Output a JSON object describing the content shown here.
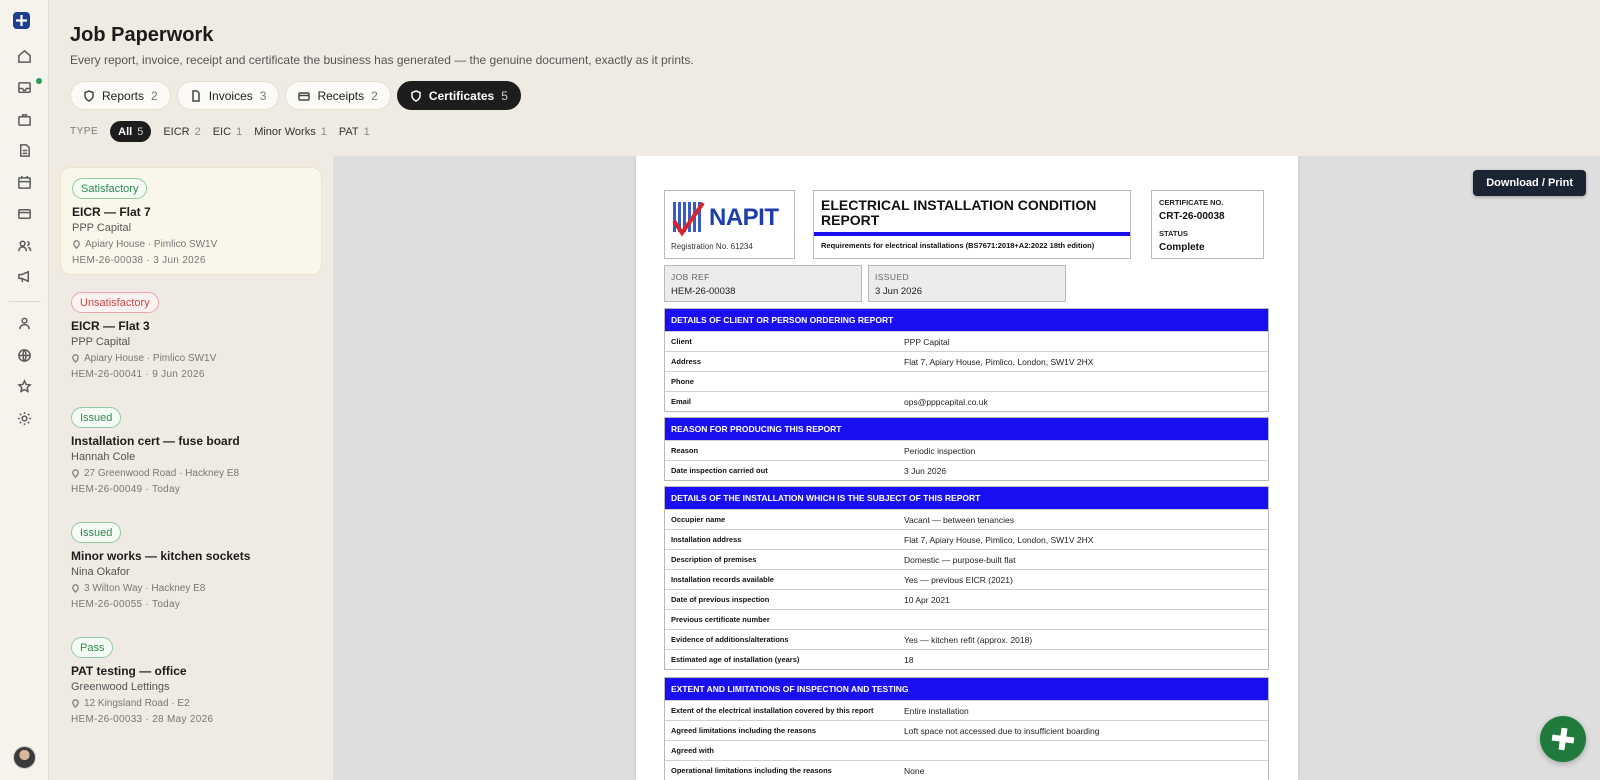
{
  "sidebar": {
    "icons": [
      "home-icon",
      "inbox-icon",
      "briefcase-icon",
      "document-icon",
      "calendar-icon",
      "card-icon",
      "people-icon",
      "megaphone-icon",
      "person-icon",
      "globe-icon",
      "star-icon",
      "settings-icon"
    ]
  },
  "header": {
    "title": "Job Paperwork",
    "subtitle": "Every report, invoice, receipt and certificate the business has generated — the genuine document, exactly as it prints.",
    "tabs": [
      {
        "label": "Reports",
        "count": "2"
      },
      {
        "label": "Invoices",
        "count": "3"
      },
      {
        "label": "Receipts",
        "count": "2"
      },
      {
        "label": "Certificates",
        "count": "5"
      }
    ],
    "type_label": "TYPE",
    "types": [
      {
        "label": "All",
        "count": "5"
      },
      {
        "label": "EICR",
        "count": "2"
      },
      {
        "label": "EIC",
        "count": "1"
      },
      {
        "label": "Minor Works",
        "count": "1"
      },
      {
        "label": "PAT",
        "count": "1"
      }
    ]
  },
  "list": [
    {
      "badge": "Satisfactory",
      "title": "EICR — Flat 7",
      "client": "PPP Capital",
      "address": "Apiary House · Pimlico SW1V",
      "meta": "HEM-26-00038 · 3 Jun 2026"
    },
    {
      "badge": "Unsatisfactory",
      "title": "EICR — Flat 3",
      "client": "PPP Capital",
      "address": "Apiary House · Pimlico SW1V",
      "meta": "HEM-26-00041 · 9 Jun 2026"
    },
    {
      "badge": "Issued",
      "title": "Installation cert — fuse board",
      "client": "Hannah Cole",
      "address": "27 Greenwood Road · Hackney E8",
      "meta": "HEM-26-00049 · Today"
    },
    {
      "badge": "Issued",
      "title": "Minor works — kitchen sockets",
      "client": "Nina Okafor",
      "address": "3 Wilton Way · Hackney E8",
      "meta": "HEM-26-00055 · Today"
    },
    {
      "badge": "Pass",
      "title": "PAT testing — office",
      "client": "Greenwood Lettings",
      "address": "12 Kingsland Road · E2",
      "meta": "HEM-26-00033 · 28 May 2026"
    }
  ],
  "viewer": {
    "download_label": "Download / Print"
  },
  "certificate": {
    "logo_text": "NAPIT",
    "registration": "Registration No. 61234",
    "title": "ELECTRICAL INSTALLATION CONDITION REPORT",
    "subtitle": "Requirements for electrical installations (BS7671:2018+A2:2022 18th edition)",
    "cert_no_label": "CERTIFICATE NO.",
    "cert_no": "CRT-26-00038",
    "status_label": "STATUS",
    "status": "Complete",
    "job_ref_label": "JOB REF",
    "job_ref": "HEM-26-00038",
    "issued_label": "ISSUED",
    "issued": "3 Jun 2026",
    "sections": [
      {
        "title": "DETAILS OF CLIENT OR PERSON ORDERING REPORT",
        "rows": [
          {
            "k": "Client",
            "v": "PPP Capital"
          },
          {
            "k": "Address",
            "v": "Flat 7, Apiary House, Pimlico, London, SW1V 2HX"
          },
          {
            "k": "Phone",
            "v": ""
          },
          {
            "k": "Email",
            "v": "ops@pppcapital.co.uk"
          }
        ]
      },
      {
        "title": "REASON FOR PRODUCING THIS REPORT",
        "rows": [
          {
            "k": "Reason",
            "v": "Periodic inspection"
          },
          {
            "k": "Date inspection carried out",
            "v": "3 Jun 2026"
          }
        ]
      },
      {
        "title": "DETAILS OF THE INSTALLATION WHICH IS THE SUBJECT OF THIS REPORT",
        "rows": [
          {
            "k": "Occupier name",
            "v": "Vacant — between tenancies"
          },
          {
            "k": "Installation address",
            "v": "Flat 7, Apiary House, Pimlico, London, SW1V 2HX"
          },
          {
            "k": "Description of premises",
            "v": "Domestic — purpose-built flat"
          },
          {
            "k": "Installation records available",
            "v": "Yes — previous EICR (2021)"
          },
          {
            "k": "Date of previous inspection",
            "v": "10 Apr 2021"
          },
          {
            "k": "Previous certificate number",
            "v": ""
          },
          {
            "k": "Evidence of additions/alterations",
            "v": "Yes — kitchen refit (approx. 2018)"
          },
          {
            "k": "Estimated age of installation (years)",
            "v": "18"
          }
        ]
      },
      {
        "title": "EXTENT AND LIMITATIONS OF INSPECTION AND TESTING",
        "rows": [
          {
            "k": "Extent of the electrical installation covered by this report",
            "v": "Entire installation"
          },
          {
            "k": "Agreed limitations including the reasons",
            "v": "Loft space not accessed due to insufficient boarding"
          },
          {
            "k": "Agreed with",
            "v": ""
          },
          {
            "k": "Operational limitations including the reasons",
            "v": "None"
          }
        ]
      }
    ]
  },
  "colors": {
    "accent": "#1a0ff0",
    "good": "#2f8b4e",
    "bad": "#c94747",
    "fab": "#1f7a3b"
  }
}
